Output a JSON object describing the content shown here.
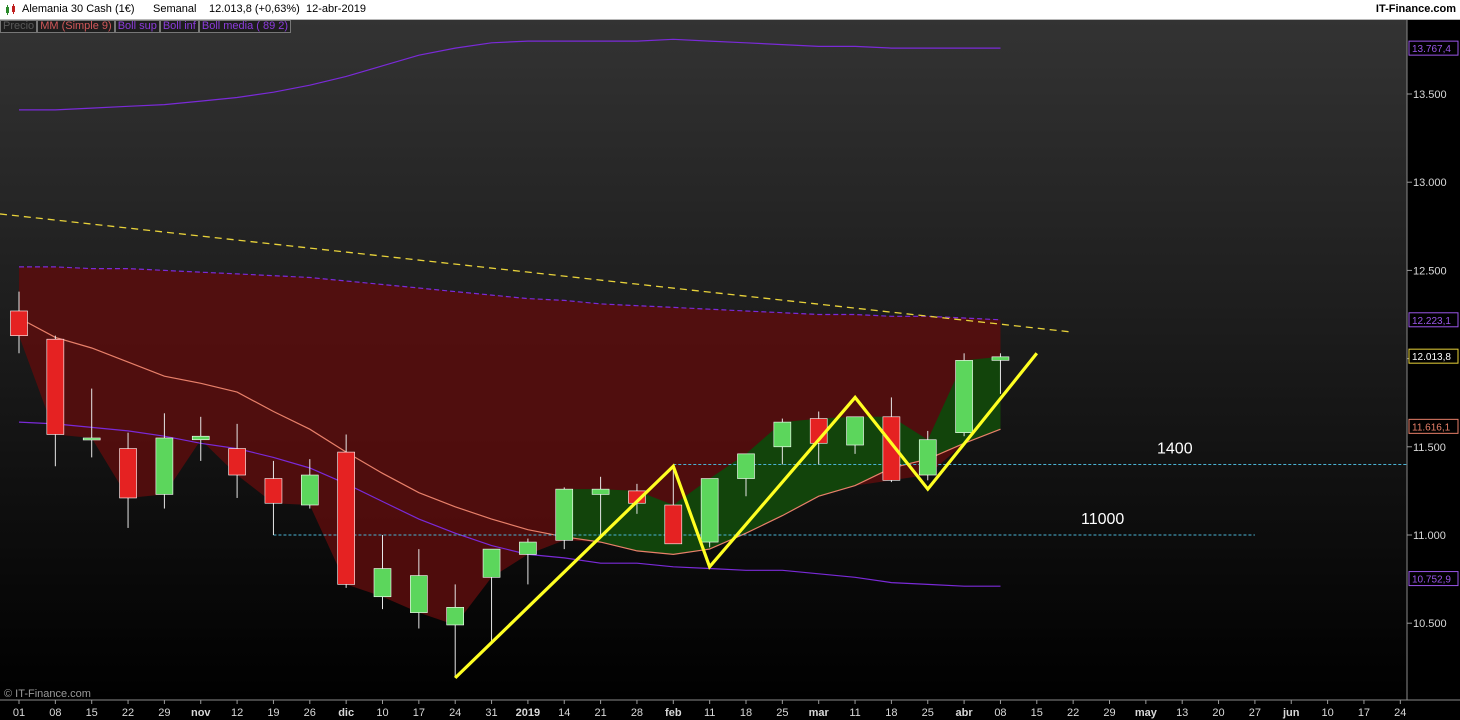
{
  "header": {
    "title": "Alemania 30 Cash (1€)",
    "period": "Semanal",
    "last": "12.013,8 (+0,63%)",
    "date": "12-abr-2019",
    "brand": "IT-Finance.com",
    "watermark": "© IT-Finance.com"
  },
  "legend": [
    {
      "label": "Precio",
      "color": "#5a5a5a"
    },
    {
      "label": "MM (Simple 9)",
      "color": "#d2585a"
    },
    {
      "label": "Boll sup",
      "color": "#8c3cdc"
    },
    {
      "label": "Boll inf",
      "color": "#8c3cdc"
    },
    {
      "label": "Boll media ( 89 2)",
      "color": "#8c3cdc"
    }
  ],
  "colors": {
    "up": "#5cd65c",
    "down": "#e52222",
    "ma": "#e8806a",
    "bollinger": "#7a2ad8",
    "trend": "#ffff22",
    "level": "#4ab3d4",
    "cloud_bear": "#5a0d0d",
    "cloud_bull": "#0b4a0b",
    "axis_text": "#d8d8d8"
  },
  "chart_data": {
    "type": "candlestick",
    "x_labels": [
      "01",
      "08",
      "15",
      "22",
      "29",
      "nov",
      "12",
      "19",
      "26",
      "dic",
      "10",
      "17",
      "24",
      "31",
      "2019",
      "14",
      "21",
      "28",
      "feb",
      "11",
      "18",
      "25",
      "mar",
      "11",
      "18",
      "25",
      "abr",
      "08",
      "15",
      "22",
      "29",
      "may",
      "13",
      "20",
      "27",
      "jun",
      "10",
      "17",
      "24"
    ],
    "ohlc": [
      [
        12270,
        12380,
        12030,
        12130
      ],
      [
        12110,
        12130,
        11390,
        11570
      ],
      [
        11550,
        11830,
        11440,
        11550
      ],
      [
        11490,
        11580,
        11040,
        11210
      ],
      [
        11230,
        11690,
        11150,
        11550
      ],
      [
        11540,
        11670,
        11420,
        11560
      ],
      [
        11490,
        11630,
        11210,
        11340
      ],
      [
        11320,
        11420,
        11000,
        11180
      ],
      [
        11170,
        11430,
        11150,
        11340
      ],
      [
        11470,
        11570,
        10700,
        10720
      ],
      [
        10650,
        11000,
        10580,
        10810
      ],
      [
        10560,
        10920,
        10470,
        10770
      ],
      [
        10490,
        10720,
        10190,
        10590
      ],
      [
        10760,
        10790,
        10400,
        10920
      ],
      [
        10890,
        10980,
        10720,
        10960
      ],
      [
        10970,
        11270,
        10920,
        11260
      ],
      [
        11230,
        11330,
        11000,
        11260
      ],
      [
        11250,
        11290,
        11120,
        11180
      ],
      [
        11170,
        11390,
        10960,
        10950
      ],
      [
        10960,
        11320,
        10930,
        11320
      ],
      [
        11320,
        11450,
        11220,
        11460
      ],
      [
        11500,
        11660,
        11400,
        11640
      ],
      [
        11660,
        11700,
        11400,
        11520
      ],
      [
        11510,
        11670,
        11460,
        11670
      ],
      [
        11670,
        11780,
        11300,
        11310
      ],
      [
        11340,
        11590,
        11310,
        11540
      ],
      [
        11580,
        12030,
        11560,
        11990
      ],
      [
        11990,
        12030,
        11800,
        12010
      ]
    ],
    "ma_simple_9": [
      12230,
      12120,
      12060,
      11980,
      11900,
      11860,
      11810,
      11700,
      11600,
      11470,
      11350,
      11240,
      11160,
      11090,
      11030,
      10990,
      10960,
      10910,
      10890,
      10920,
      11010,
      11110,
      11220,
      11280,
      11380,
      11430,
      11520,
      11600
    ],
    "boll_sup": [
      13410,
      13410,
      13420,
      13430,
      13440,
      13460,
      13480,
      13510,
      13550,
      13600,
      13660,
      13720,
      13760,
      13790,
      13800,
      13800,
      13800,
      13800,
      13810,
      13800,
      13790,
      13780,
      13770,
      13770,
      13760,
      13760,
      13760,
      13760
    ],
    "boll_media": [
      12520,
      12520,
      12510,
      12510,
      12500,
      12490,
      12480,
      12470,
      12460,
      12440,
      12420,
      12400,
      12380,
      12360,
      12340,
      12330,
      12310,
      12300,
      12290,
      12280,
      12270,
      12260,
      12250,
      12250,
      12240,
      12240,
      12230,
      12220
    ],
    "boll_inf": [
      11640,
      11630,
      11610,
      11590,
      11560,
      11520,
      11490,
      11440,
      11380,
      11290,
      11190,
      11090,
      11010,
      10940,
      10890,
      10870,
      10840,
      10840,
      10820,
      10810,
      10800,
      10800,
      10780,
      10760,
      10730,
      10720,
      10710,
      10710
    ],
    "zigzag": [
      [
        12,
        10190
      ],
      [
        18,
        11390
      ],
      [
        19,
        10820
      ],
      [
        23,
        11780
      ],
      [
        25,
        11260
      ],
      [
        28,
        12030
      ]
    ],
    "dashed_resistance": {
      "from": [
        0,
        12820
      ],
      "to": [
        28,
        12150
      ]
    },
    "levels": [
      {
        "label": "1400",
        "value": 11400
      },
      {
        "label": "11000",
        "value": 11000
      }
    ],
    "y_axis": {
      "ticks": [
        "10.500",
        "11.000",
        "11.500",
        "12.000",
        "12.500",
        "13.000",
        "13.500"
      ],
      "min": 10000,
      "max": 13900
    },
    "axis_tags": [
      {
        "text": "13.767,4",
        "value": 13760,
        "color": "#9a56e8"
      },
      {
        "text": "12.223,1",
        "value": 12220,
        "color": "#9a56e8"
      },
      {
        "text": "12.013,8",
        "value": 12013.8,
        "color": "#ffffff"
      },
      {
        "text": "11.616,1",
        "value": 11616,
        "color": "#e8806a"
      },
      {
        "text": "10.752,9",
        "value": 10753,
        "color": "#9a56e8"
      }
    ]
  }
}
